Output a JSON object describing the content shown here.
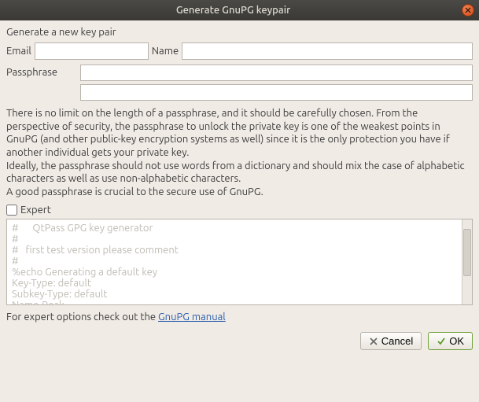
{
  "window": {
    "title": "Generate GnuPG keypair"
  },
  "heading": "Generate a new key pair",
  "form": {
    "email_label": "Email",
    "email_value": "",
    "name_label": "Name",
    "name_value": "",
    "passphrase_label": "Passphrase",
    "passphrase_value": "",
    "passphrase_confirm_value": ""
  },
  "helptext": "There is no limit on the length of a passphrase, and it should be carefully chosen. From the perspective of security, the passphrase to unlock the private key is one of the weakest points in GnuPG (and other public-key encryption systems as well) since it is the only protection you have if another individual gets your private key.\nIdeally, the passphrase should not use words from a dictionary and should mix the case of alphabetic characters as well as use non-alphabetic characters.\nA good passphrase is crucial to the secure use of GnuPG.",
  "expert": {
    "label": "Expert",
    "checked": false
  },
  "expert_text": "#      QtPass GPG key generator\n#\n#   first test version please comment\n#\n%echo Generating a default key\nKey-Type: default\nSubkey-Type: default\nName-Real:",
  "linkline_prefix": "For expert options check out the ",
  "linkline_link": "GnuPG manual",
  "buttons": {
    "cancel": "Cancel",
    "ok": "OK"
  }
}
